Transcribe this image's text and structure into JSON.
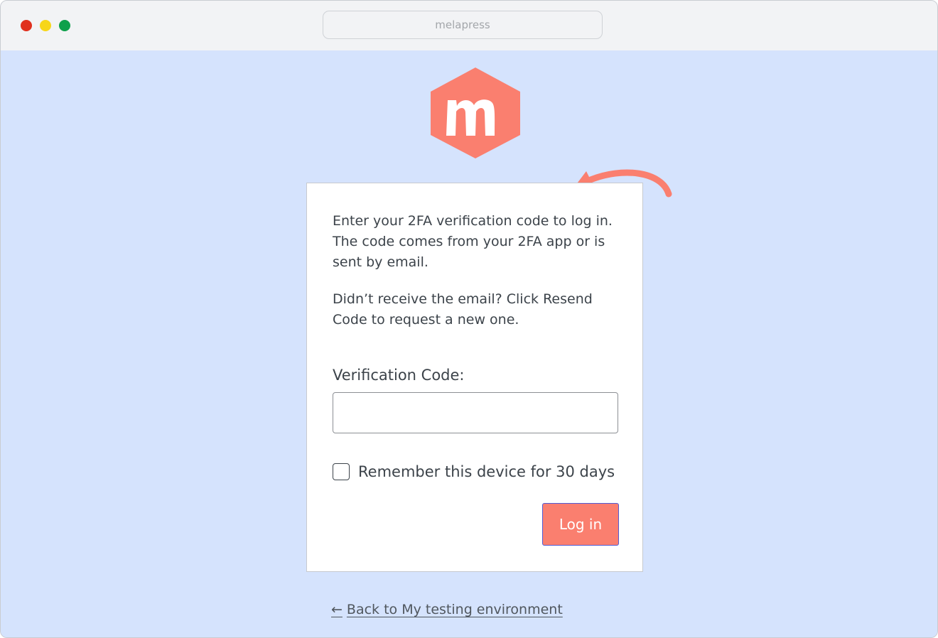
{
  "browser": {
    "url_text": "melapress"
  },
  "logo": {
    "letter": "m",
    "color": "#fa7f6f"
  },
  "form": {
    "message_1": "Enter your 2FA verification code to log in. The code comes from your 2FA app or is sent by email.",
    "message_2": "Didn’t receive the email? Click Resend Code to request a new one.",
    "code_label": "Verification Code:",
    "code_value": "",
    "remember_label": "Remember this device for 30 days",
    "remember_checked": false,
    "login_label": "Log in"
  },
  "footer": {
    "back_arrow": "←",
    "back_link": "Back to My testing environment"
  },
  "colors": {
    "background": "#d5e3fd",
    "accent": "#fa7f6f",
    "button_border": "#4f5bd5",
    "text": "#3c434a"
  }
}
